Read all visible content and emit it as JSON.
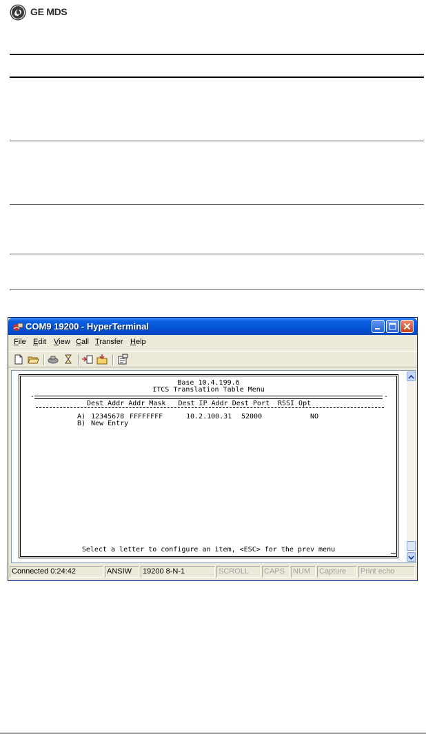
{
  "brand": {
    "name": "GE MDS"
  },
  "window": {
    "title": "COM9 19200 - HyperTerminal",
    "menu": [
      {
        "label": "File",
        "accel": "F"
      },
      {
        "label": "Edit",
        "accel": "E"
      },
      {
        "label": "View",
        "accel": "V"
      },
      {
        "label": "Call",
        "accel": "C"
      },
      {
        "label": "Transfer",
        "accel": "T"
      },
      {
        "label": "Help",
        "accel": "H"
      }
    ],
    "toolbar": [
      "new-icon",
      "open-icon",
      "disconnect-icon",
      "call-icon",
      "send-icon",
      "receive-icon",
      "properties-icon"
    ]
  },
  "terminal": {
    "header_line1": "Base 10.4.199.6",
    "header_line2": "ITCS Translation Table Menu",
    "column_headers": "Dest Addr Addr Mask   Dest IP Addr Dest Port  RSSI Opt",
    "rows": [
      {
        "key": "A)",
        "dest_addr": "12345678",
        "addr_mask": "FFFFFFFF",
        "dest_ip": "10.2.100.31",
        "dest_port": "52000",
        "rssi_opt": "NO"
      },
      {
        "key": "B)",
        "label": "New Entry"
      }
    ],
    "footer": "Select a letter to configure an item, <ESC> for the prev menu"
  },
  "statusbar": [
    {
      "text": "Connected 0:24:42",
      "dim": false
    },
    {
      "text": "ANSIW",
      "dim": false
    },
    {
      "text": "19200 8-N-1",
      "dim": false
    },
    {
      "text": "SCROLL",
      "dim": true
    },
    {
      "text": "CAPS",
      "dim": true
    },
    {
      "text": "NUM",
      "dim": true
    },
    {
      "text": "Capture",
      "dim": true
    },
    {
      "text": "Print echo",
      "dim": true
    }
  ]
}
